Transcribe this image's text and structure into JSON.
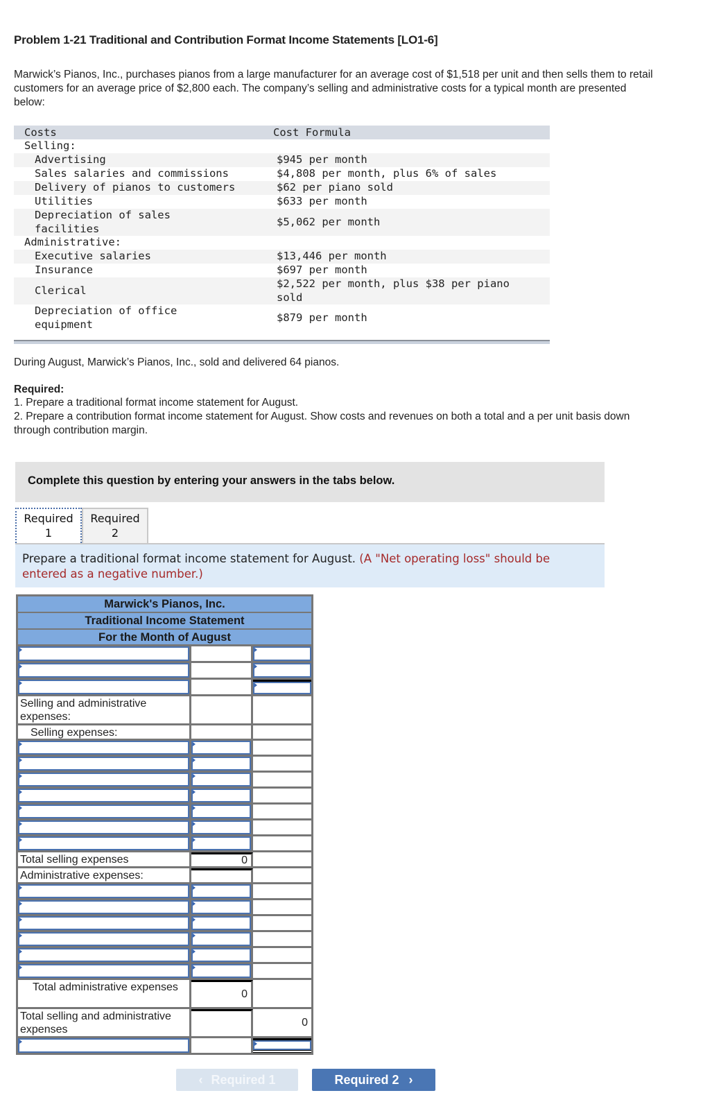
{
  "problem": {
    "title": "Problem 1-21 Traditional and Contribution Format Income Statements [LO1-6]",
    "intro": "Marwick’s Pianos, Inc., purchases pianos from a large manufacturer for an average cost of $1,518 per unit and then sells them to retail customers for an average price of $2,800 each. The company’s selling and administrative costs for a typical month are presented below:"
  },
  "cost_table": {
    "headers": [
      "Costs",
      "Cost Formula"
    ],
    "selling_label": "Selling:",
    "selling": [
      {
        "cost": "Advertising",
        "formula": "$945 per month"
      },
      {
        "cost": "Sales salaries and commissions",
        "formula": "$4,808 per month, plus 6% of sales"
      },
      {
        "cost": "Delivery of pianos to customers",
        "formula": "$62 per piano sold"
      },
      {
        "cost": "Utilities",
        "formula": "$633 per month"
      },
      {
        "cost": "Depreciation of sales facilities",
        "formula": "$5,062 per month"
      }
    ],
    "admin_label": "Administrative:",
    "administrative": [
      {
        "cost": "Executive salaries",
        "formula": "$13,446 per month"
      },
      {
        "cost": "Insurance",
        "formula": "$697 per month"
      },
      {
        "cost": "Clerical",
        "formula": "$2,522 per month, plus $38 per piano sold"
      },
      {
        "cost": "Depreciation of office equipment",
        "formula": "$879 per month"
      }
    ]
  },
  "facts": {
    "august": "During August, Marwick’s Pianos, Inc., sold and delivered 64 pianos.",
    "required_label": "Required:",
    "req1": "1. Prepare a traditional format income statement for August.",
    "req2": "2. Prepare a contribution format income statement for August. Show costs and revenues on both a total and a per unit basis down through contribution margin."
  },
  "instructions_banner": "Complete this question by entering your answers in the tabs below.",
  "tabs": [
    {
      "line1": "Required",
      "line2": "1",
      "active": true
    },
    {
      "line1": "Required",
      "line2": "2",
      "active": false
    }
  ],
  "tab_instruction": {
    "text": "Prepare a traditional format income statement for August.",
    "note": "(A \"Net operating loss\" should be entered as a negative number.)"
  },
  "statement": {
    "company": "Marwick's Pianos, Inc.",
    "title": "Traditional Income Statement",
    "period": "For the Month of August",
    "labels": {
      "sa_expenses": "Selling and administrative expenses:",
      "selling_expenses": "Selling expenses:",
      "total_selling": "Total selling expenses",
      "admin_expenses": "Administrative expenses:",
      "total_admin": "Total administrative expenses",
      "total_sa": "Total selling and administrative expenses"
    },
    "values": {
      "total_selling": "0",
      "total_admin": "0",
      "total_sa": "0"
    }
  },
  "nav": {
    "prev_label": "Required 1",
    "next_label": "Required 2",
    "prev_icon": "‹",
    "next_icon": "›"
  }
}
